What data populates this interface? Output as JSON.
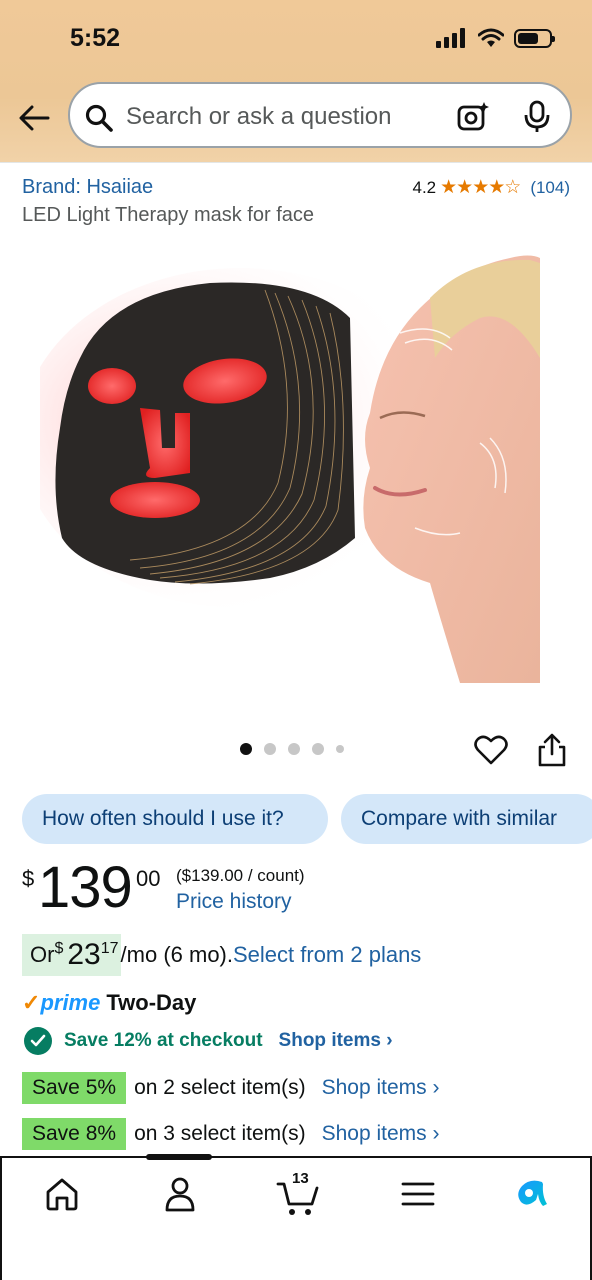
{
  "status_bar": {
    "time": "5:52"
  },
  "search": {
    "placeholder": "Search or ask a question"
  },
  "product": {
    "brand": "Brand: Hsaiiae",
    "rating": "4.2",
    "stars": "★★★★☆",
    "rating_value": 4.2,
    "review_count": "(104)",
    "title": "LED Light Therapy mask for face"
  },
  "gallery": {
    "image_count": 5,
    "active_index": 0
  },
  "chips": [
    "How often should I use it?",
    "Compare with similar"
  ],
  "price": {
    "symbol": "$",
    "whole": "139",
    "fraction": "00",
    "unit_price": "($139.00 / count)",
    "history_label": "Price history"
  },
  "installment": {
    "prefix": "Or ",
    "symbol": "$",
    "amount": "23",
    "cents": "17",
    "suffix": "/mo (6 mo).",
    "link": "Select from 2 plans"
  },
  "prime": {
    "check": "✓",
    "word": "prime",
    "label": "Two-Day"
  },
  "checkout_save": {
    "text": "Save 12% at checkout",
    "link": "Shop items ›"
  },
  "promos": [
    {
      "badge": "Save 5%",
      "text": "on 2 select item(s)",
      "link": "Shop items ›"
    },
    {
      "badge": "Save 8%",
      "text": "on 3 select item(s)",
      "link": "Shop items ›"
    }
  ],
  "nav": {
    "cart_count": "13"
  },
  "colors": {
    "link": "#2162a1",
    "header": "#f0c998",
    "promo_green": "#7fda69",
    "save_green": "#067d62"
  }
}
